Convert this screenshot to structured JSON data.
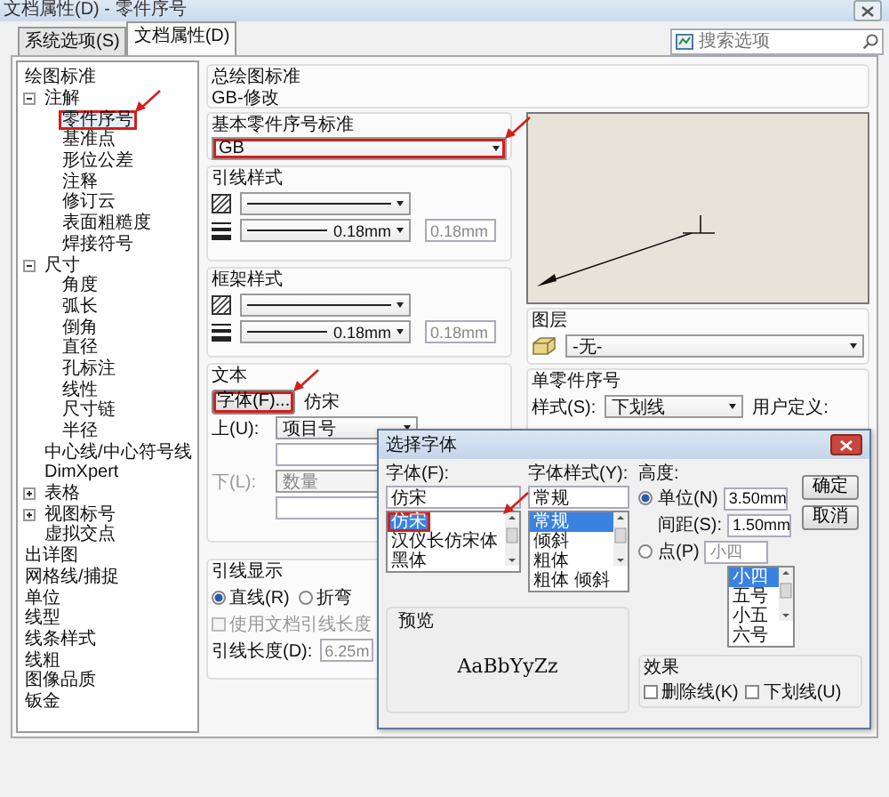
{
  "window": {
    "title": "文档属性(D) - 零件序号"
  },
  "tabs": [
    {
      "label": "系统选项(S)",
      "selected": false
    },
    {
      "label": "文档属性(D)",
      "selected": true
    }
  ],
  "search": {
    "placeholder": "搜索选项"
  },
  "tree": [
    {
      "label": "绘图标准",
      "selected": false,
      "children": [
        {
          "label": "注解",
          "selected": false,
          "expanded": true,
          "children": [
            {
              "label": "零件序号",
              "selected": true,
              "annotated": true
            },
            {
              "label": "基准点",
              "selected": false
            },
            {
              "label": "形位公差",
              "selected": false
            },
            {
              "label": "注释",
              "selected": false
            },
            {
              "label": "修订云",
              "selected": false
            },
            {
              "label": "表面粗糙度",
              "selected": false
            },
            {
              "label": "焊接符号",
              "selected": false
            }
          ]
        },
        {
          "label": "尺寸",
          "selected": false,
          "expanded": true,
          "children": [
            {
              "label": "角度",
              "selected": false
            },
            {
              "label": "弧长",
              "selected": false
            },
            {
              "label": "倒角",
              "selected": false
            },
            {
              "label": "直径",
              "selected": false
            },
            {
              "label": "孔标注",
              "selected": false
            },
            {
              "label": "线性",
              "selected": false
            },
            {
              "label": "尺寸链",
              "selected": false
            },
            {
              "label": "半径",
              "selected": false
            }
          ]
        },
        {
          "label": "中心线/中心符号线",
          "selected": false
        },
        {
          "label": "DimXpert",
          "selected": false
        },
        {
          "label": "表格",
          "selected": false,
          "expanded": false
        },
        {
          "label": "视图标号",
          "selected": false,
          "expanded": false
        },
        {
          "label": "虚拟交点",
          "selected": false
        }
      ]
    },
    {
      "label": "出详图",
      "selected": false
    },
    {
      "label": "网格线/捕捉",
      "selected": false
    },
    {
      "label": "单位",
      "selected": false
    },
    {
      "label": "线型",
      "selected": false
    },
    {
      "label": "线条样式",
      "selected": false
    },
    {
      "label": "线粗",
      "selected": false
    },
    {
      "label": "图像品质",
      "selected": false
    },
    {
      "label": "钣金",
      "selected": false
    }
  ],
  "drawing_standard": {
    "label": "总绘图标准",
    "value": "GB-修改"
  },
  "balloon_standard": {
    "label": "基本零件序号标准",
    "value": "GB",
    "annotated": true
  },
  "leader_style": {
    "label": "引线样式",
    "width_value": "0.18mm",
    "width_field": "0.18mm"
  },
  "frame_style": {
    "label": "框架样式",
    "width_value": "0.18mm",
    "width_field": "0.18mm"
  },
  "text": {
    "label": "文本",
    "font_button": "字体(F)...",
    "font_button_annotated": true,
    "font_name": "仿宋",
    "upper_label": "上(U):",
    "upper_value": "项目号",
    "lower_label": "下(L):",
    "lower_value": "数量",
    "lower_disabled": true
  },
  "leader_display": {
    "label": "引线显示",
    "options": [
      {
        "label": "直线(R)",
        "selected": true
      },
      {
        "label": "折弯",
        "selected": false
      }
    ],
    "use_doc_length": {
      "label": "使用文档引线长度",
      "checked": false,
      "disabled": true
    },
    "length_label": "引线长度(D):",
    "length_value": "6.25m"
  },
  "layer": {
    "label": "图层",
    "value": "-无-"
  },
  "single_balloon": {
    "label": "单零件序号",
    "style_label": "样式(S):",
    "style_value": "下划线",
    "user_defined": "用户定义:"
  },
  "font_dialog": {
    "title": "选择字体",
    "font_label": "字体(F):",
    "font_value": "仿宋",
    "fonts": [
      {
        "label": "仿宋",
        "selected": true,
        "annotated": true
      },
      {
        "label": "汉仪长仿宋体",
        "selected": false
      },
      {
        "label": "黑体",
        "selected": false
      }
    ],
    "style_label": "字体样式(Y):",
    "style_value": "常规",
    "styles": [
      {
        "label": "常规",
        "selected": true
      },
      {
        "label": "倾斜",
        "selected": false
      },
      {
        "label": "粗体",
        "selected": false
      },
      {
        "label": "粗体 倾斜",
        "selected": false
      }
    ],
    "height_label": "高度:",
    "height_modes": [
      {
        "label": "单位(N)",
        "selected": true,
        "value": "3.50mm"
      },
      {
        "label": "点(P)",
        "selected": false,
        "value": "小四"
      }
    ],
    "spacing_label": "间距(S):",
    "spacing_value": "1.50mm",
    "sizes": [
      {
        "label": "小四",
        "selected": true
      },
      {
        "label": "五号",
        "selected": false
      },
      {
        "label": "小五",
        "selected": false
      },
      {
        "label": "六号",
        "selected": false
      }
    ],
    "preview_label": "预览",
    "preview_text": "AaBbYyZz",
    "effects_label": "效果",
    "effects": [
      {
        "label": "删除线(K)",
        "checked": false
      },
      {
        "label": "下划线(U)",
        "checked": false
      }
    ],
    "buttons": [
      "确定",
      "取消"
    ]
  }
}
